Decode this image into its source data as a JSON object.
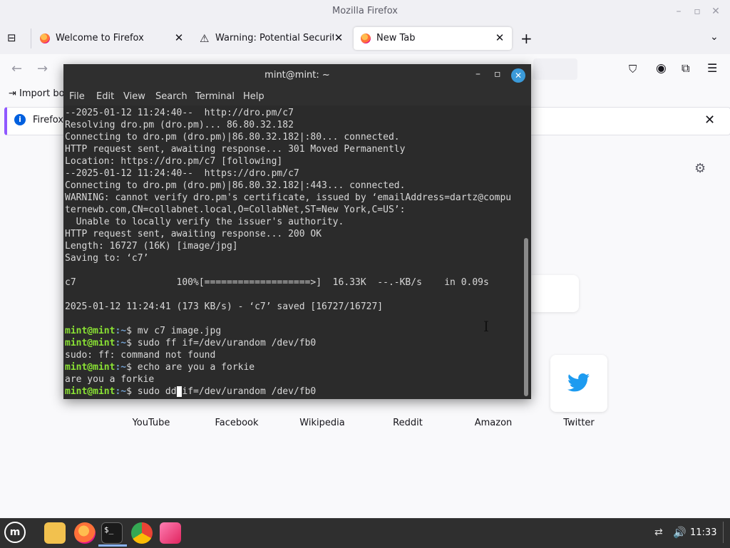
{
  "window": {
    "title": "Mozilla Firefox"
  },
  "tabs": [
    {
      "label": "Welcome to Firefox"
    },
    {
      "label": "Warning: Potential Security"
    },
    {
      "label": "New Tab"
    }
  ],
  "bookmarks": {
    "import_label": "Import bo"
  },
  "notice": {
    "text": "Firefox"
  },
  "shortcuts": [
    "YouTube",
    "Facebook",
    "Wikipedia",
    "Reddit",
    "Amazon",
    "Twitter"
  ],
  "terminal": {
    "title": "mint@mint: ~",
    "menu": [
      "File",
      "Edit",
      "View",
      "Search",
      "Terminal",
      "Help"
    ],
    "output_lines": [
      "--2025-01-12 11:24:40--  http://dro.pm/c7",
      "Resolving dro.pm (dro.pm)... 86.80.32.182",
      "Connecting to dro.pm (dro.pm)|86.80.32.182|:80... connected.",
      "HTTP request sent, awaiting response... 301 Moved Permanently",
      "Location: https://dro.pm/c7 [following]",
      "--2025-01-12 11:24:40--  https://dro.pm/c7",
      "Connecting to dro.pm (dro.pm)|86.80.32.182|:443... connected.",
      "WARNING: cannot verify dro.pm's certificate, issued by ‘emailAddress=dartz@compu",
      "ternewb.com,CN=collabnet.local,O=CollabNet,ST=New York,C=US’:",
      "  Unable to locally verify the issuer's authority.",
      "HTTP request sent, awaiting response... 200 OK",
      "Length: 16727 (16K) [image/jpg]",
      "Saving to: ‘c7’",
      "",
      "c7                  100%[===================>]  16.33K  --.-KB/s    in 0.09s",
      "",
      "2025-01-12 11:24:41 (173 KB/s) - ‘c7’ saved [16727/16727]",
      ""
    ],
    "prompt_user": "mint@mint",
    "prompt_path": ":~",
    "prompt_symbol": "$ ",
    "session": [
      {
        "cmd": "mv c7 image.jpg",
        "out": ""
      },
      {
        "cmd": "sudo ff if=/dev/urandom /dev/fb0",
        "out": "sudo: ff: command not found"
      },
      {
        "cmd": "echo are you a forkie",
        "out": "are you a forkie"
      }
    ],
    "current_cmd_before": "sudo dd",
    "current_cmd_after": "if=/dev/urandom /dev/fb0"
  },
  "taskbar": {
    "clock": "11:33"
  }
}
